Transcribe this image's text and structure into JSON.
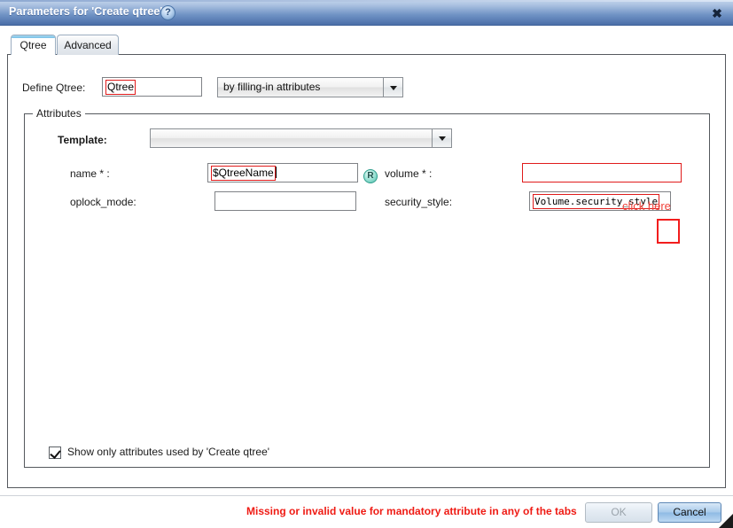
{
  "window": {
    "title": "Parameters for 'Create qtree'",
    "help_icon": "help-circle-icon",
    "close_icon": "close-icon",
    "close_label": "✖"
  },
  "tabs": [
    {
      "label": "Qtree",
      "active": true
    },
    {
      "label": "Advanced",
      "active": false
    }
  ],
  "define_row": {
    "label": "Define Qtree:",
    "input_value": "Qtree",
    "mode_value": "by filling-in attributes"
  },
  "attributes": {
    "legend": "Attributes",
    "template": {
      "label": "Template:",
      "value": ""
    },
    "fields": [
      {
        "label": "name * :",
        "value": "$QtreeName",
        "badge": "R",
        "badge_name": "required-reference-badge"
      },
      {
        "label": "volume * :",
        "value": ""
      },
      {
        "label": "oplock_mode:",
        "value": ""
      },
      {
        "label": "security_style:",
        "value": "Volume.security_style"
      }
    ],
    "show_only_checkbox": {
      "label": "Show only attributes used by 'Create qtree'",
      "checked": true
    }
  },
  "annotation": {
    "text": "click here",
    "color": "#f0443c",
    "box_color": "#f21d1d"
  },
  "footer": {
    "error_message": "Missing or invalid value for mandatory attribute in any of the tabs",
    "ok_label": "OK",
    "cancel_label": "Cancel",
    "ok_disabled": true
  },
  "colors": {
    "title_bar_start": "#c3d4ec",
    "title_bar_end": "#4a6ea8",
    "error_red": "#ef1b14",
    "invalid_border": "#e01b1b",
    "badge_teal": "#4fbfae"
  }
}
